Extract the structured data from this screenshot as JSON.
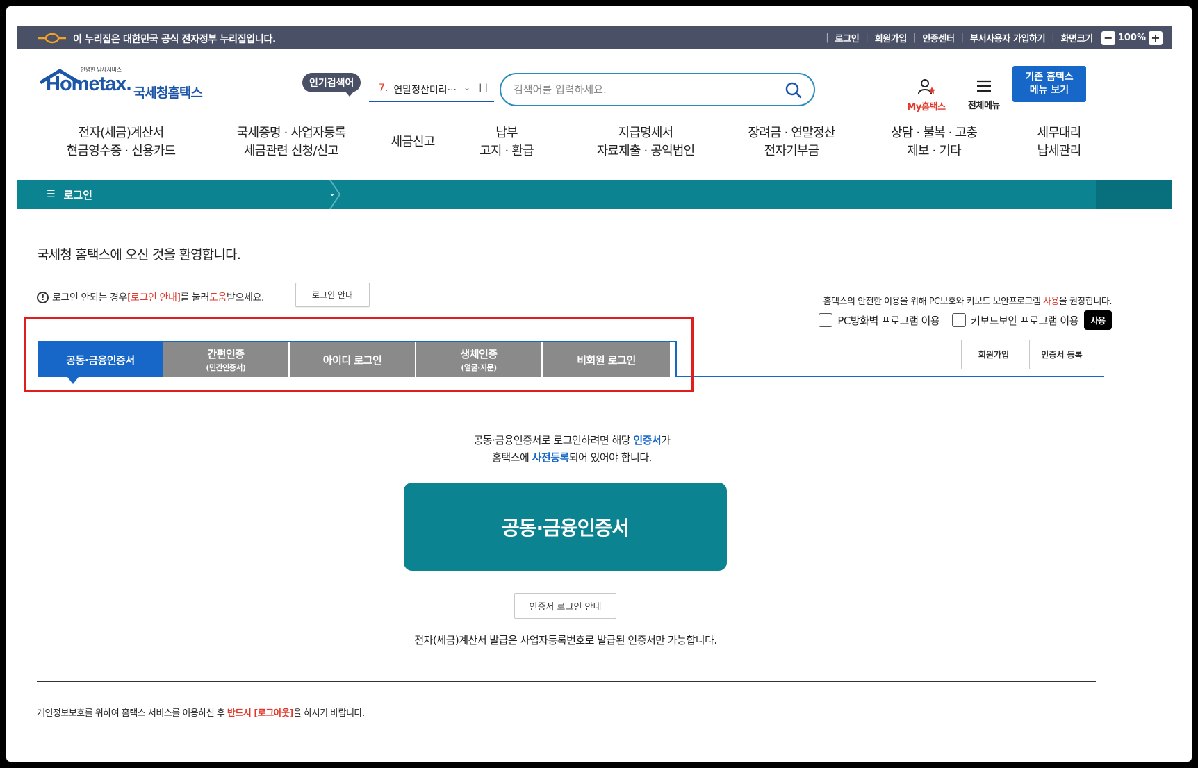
{
  "gov_bar": {
    "text": "이 누리집은 대한민국 공식 전자정부 누리집입니다.",
    "links": [
      "로그인",
      "회원가입",
      "인증센터",
      "부서사용자 가입하기",
      "화면크기"
    ],
    "zoom": "100%",
    "zoom_minus": "−",
    "zoom_plus": "+"
  },
  "header": {
    "logo_tag": "안녕한 납세서비스",
    "logo_word": "Hometax.",
    "logo_kor": "국세청홈택스",
    "popular_badge": "인기검색어",
    "popular_num": "7.",
    "popular_term": "연말정산미리···",
    "search_placeholder": "검색어를 입력하세요.",
    "my_home": "My홈택스",
    "all_menu": "전체메뉴",
    "old_menu_line1": "기존 홈택스",
    "old_menu_line2": "메뉴 보기"
  },
  "gnb": [
    {
      "l1": "전자(세금)계산서",
      "l2": "현금영수증 · 신용카드"
    },
    {
      "l1": "국세증명 · 사업자등록",
      "l2": "세금관련 신청/신고"
    },
    {
      "l1": "세금신고",
      "l2": ""
    },
    {
      "l1": "납부",
      "l2": "고지 · 환급"
    },
    {
      "l1": "지급명세서",
      "l2": "자료제출 · 공익법인"
    },
    {
      "l1": "장려금 · 연말정산",
      "l2": "전자기부금"
    },
    {
      "l1": "상담 · 불복 · 고충",
      "l2": "제보 · 기타"
    },
    {
      "l1": "세무대리",
      "l2": "납세관리"
    }
  ],
  "location": {
    "current": "로그인"
  },
  "content": {
    "welcome": "국세청 홈택스에 오신 것을 환영합니다.",
    "help_pre": "로그인 안되는 경우 ",
    "help_link": "[로그인 안내]",
    "help_mid": "를 눌러 ",
    "help_red": "도움",
    "help_post": "받으세요.",
    "login_guide_btn": "로그인 안내",
    "sec_notice_pre": "홈택스의 안전한 이용을 위해 PC보호와 키보드 보안프로그램 ",
    "sec_notice_red": "사용",
    "sec_notice_post": "을 권장합니다.",
    "firewall_label": "PC방화벽 프로그램 이용",
    "keyboard_label": "키보드보안 프로그램 이용",
    "use_btn": "사용",
    "signup_btn": "회원가입",
    "cert_register_btn": "인증서 등록"
  },
  "tabs": [
    {
      "label": "공동·금융인증서",
      "sub": "",
      "active": true
    },
    {
      "label": "간편인증",
      "sub": "(민간인증서)",
      "active": false
    },
    {
      "label": "아이디 로그인",
      "sub": "",
      "active": false
    },
    {
      "label": "생체인증",
      "sub": "(얼굴·지문)",
      "active": false
    },
    {
      "label": "비회원 로그인",
      "sub": "",
      "active": false
    }
  ],
  "cert": {
    "desc1_pre": "공동·금융인증서로 로그인하려면 해당 ",
    "desc1_blue": "인증서",
    "desc1_post": "가",
    "desc2_pre": "홈택스에 ",
    "desc2_blue": "사전등록",
    "desc2_post": "되어 있어야 합니다.",
    "big_btn": "공동·금융인증서",
    "guide_btn": "인증서 로그인 안내",
    "note": "전자(세금)계산서 발급은 사업자등록번호로 발급된 인증서만 가능합니다."
  },
  "footer": {
    "pre": "개인정보보호를 위하여 홈택스 서비스를 이용하신 후 ",
    "red": "반드시 [로그아웃]",
    "post": "을 하시기 바랍니다."
  },
  "colors": {
    "gov_bar": "#4a5066",
    "teal": "#0b8391",
    "blue": "#1767c8",
    "red": "#e0392b",
    "highlight": "#e01e1e"
  }
}
